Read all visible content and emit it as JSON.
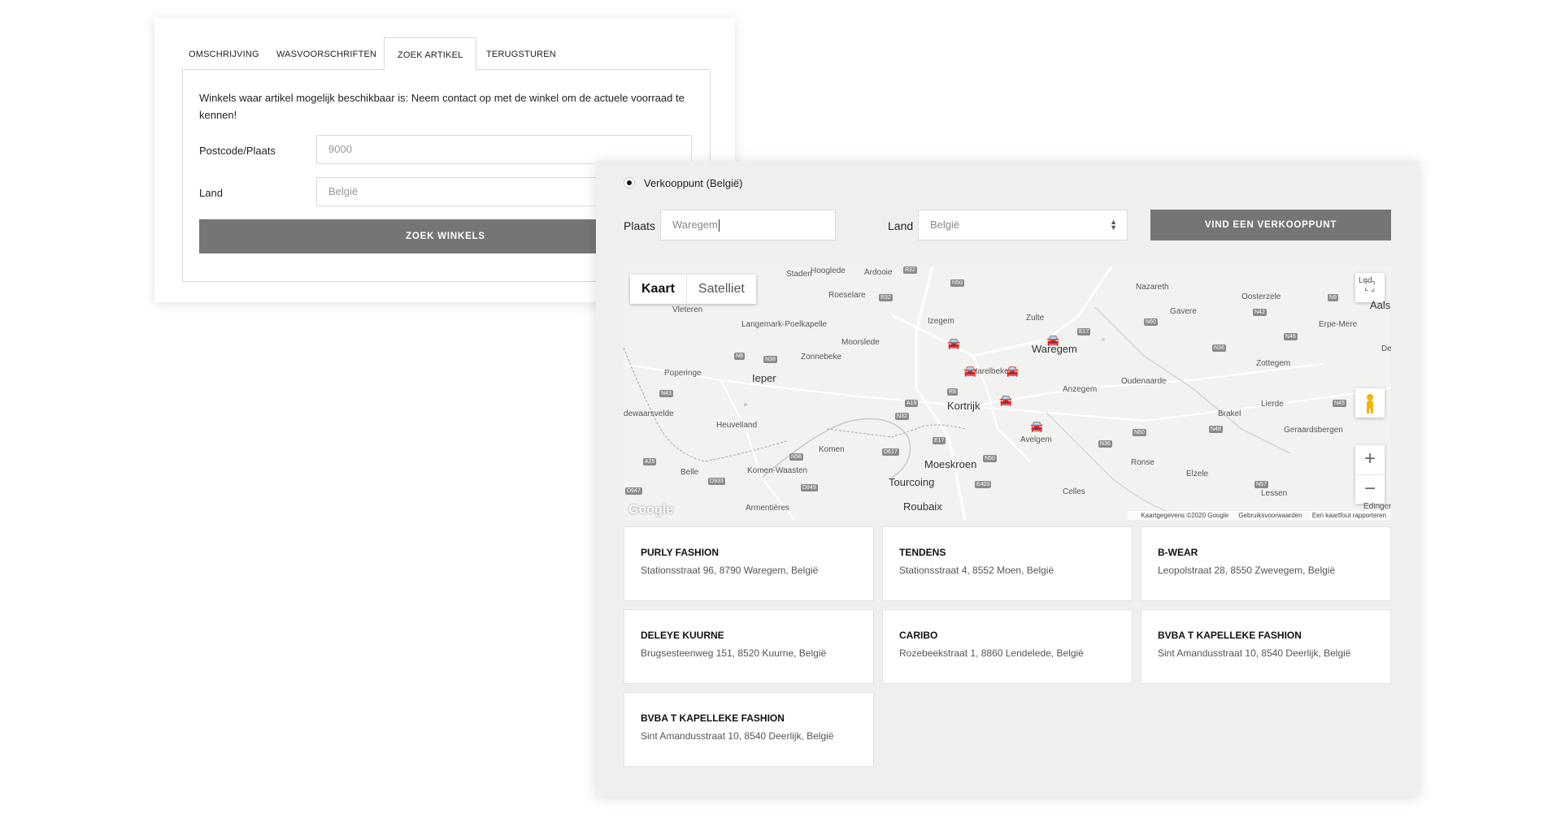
{
  "back_card": {
    "tabs": [
      "OMSCHRIJVING",
      "WASVOORSCHRIFTEN",
      "ZOEK ARTIKEL",
      "TERUGSTUREN"
    ],
    "active_tab": "ZOEK ARTIKEL",
    "description": "Winkels waar artikel mogelijk beschikbaar is: Neem contact op met de winkel om de actuele voorraad te kennen!",
    "postcode_label": "Postcode/Plaats",
    "postcode_value": "9000",
    "land_label": "Land",
    "land_value": "België",
    "search_button": "ZOEK WINKELS"
  },
  "front_card": {
    "radio_label": "Verkooppunt (België)",
    "plaats_label": "Plaats",
    "plaats_value": "Waregem",
    "land_label": "Land",
    "land_value": "België",
    "find_button": "VIND EEN VERKOOPPUNT",
    "map": {
      "toggle": [
        "Kaart",
        "Satelliet"
      ],
      "active_view": "Kaart",
      "footer": [
        "Kaartgegevens ©2020 Google",
        "Gebruiksvoorwaarden",
        "Een kaartfout rapporteren"
      ],
      "logo": "Google",
      "cities": [
        "Staden",
        "Hooglede",
        "Ardooie",
        "Roeselare",
        "Nazareth",
        "Vleteren",
        "Langemark-Poelkapelle",
        "Izegem",
        "Zulte",
        "Gavere",
        "Oosterzele",
        "Erpe-Mere",
        "Aals",
        "Led",
        "Moorslede",
        "Zonnebeke",
        "Waregem",
        "Poperinge",
        "Ieper",
        "Harelbeke",
        "Oudenaarde",
        "Zottegem",
        "Den",
        "Kortrijk",
        "Anzegem",
        "Lierde",
        "Brakel",
        "dewaarsvelde",
        "Heuvelland",
        "Komen",
        "Avelgem",
        "Geraardsbergen",
        "Belle",
        "Komen-Waasten",
        "Moeskroen",
        "Ronse",
        "Elzele",
        "Tourcoing",
        "Celles",
        "Lessen",
        "Armentières",
        "Roubaix",
        "Edingen"
      ],
      "big_cities": [
        "Kortrijk",
        "Tourcoing",
        "Roubaix",
        "Moeskroen",
        "Waregem",
        "Roeselare",
        "Ieper"
      ],
      "roads": [
        "R32",
        "N50",
        "E17",
        "N60",
        "N42",
        "N9",
        "N46",
        "N8",
        "N38",
        "N36",
        "N43",
        "A19",
        "N32",
        "R8",
        "E17",
        "N60",
        "N48",
        "N45",
        "A25",
        "N58",
        "D933",
        "D949",
        "D947",
        "N50",
        "E403",
        "N57",
        "N36",
        "R32",
        "D617"
      ]
    }
  },
  "stores": [
    {
      "name": "PURLY FASHION",
      "address": "Stationsstraat 96, 8790 Waregem, België"
    },
    {
      "name": "TENDENS",
      "address": "Stationsstraat 4, 8552 Moen, België"
    },
    {
      "name": "B-WEAR",
      "address": "Leopolstraat 28, 8550 Zwevegem, België"
    },
    {
      "name": "DELEYE KUURNE",
      "address": "Brugsesteenweg 151, 8520 Kuurne, België"
    },
    {
      "name": "CARIBO",
      "address": "Rozebeekstraat 1, 8860 Lendelede, België"
    },
    {
      "name": "BVBA T KAPELLEKE FASHION",
      "address": "Sint Amandusstraat 10, 8540 Deerlijk, België"
    },
    {
      "name": "BVBA T KAPELLEKE FASHION",
      "address": "Sint Amandusstraat 10, 8540 Deerlijk, België"
    }
  ],
  "colors": {
    "button": "#757575",
    "panel_bg": "#efefef",
    "map_bg": "#f2f2f0"
  }
}
